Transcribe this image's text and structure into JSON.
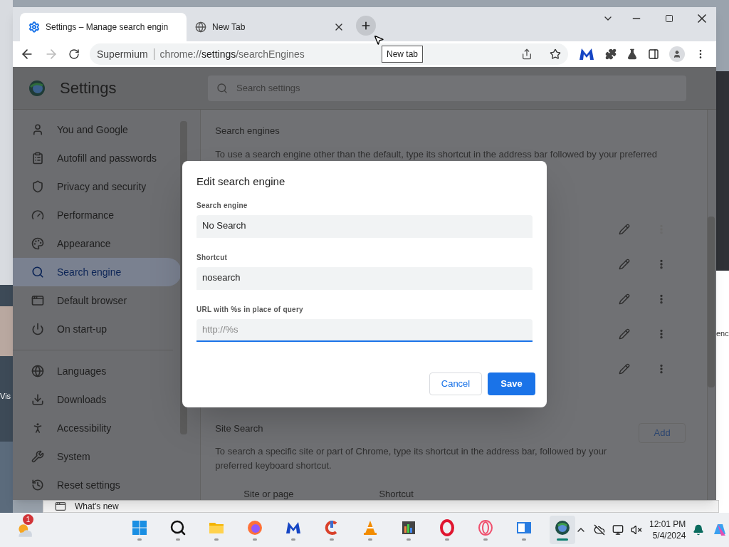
{
  "desktop_fragments": [
    {
      "text": "Vis"
    },
    {
      "text": "enc"
    }
  ],
  "window": {
    "tabs": [
      {
        "title": "Settings – Manage search engin",
        "kind": "settings",
        "selected": true
      },
      {
        "title": "New Tab",
        "kind": "globe",
        "selected": false
      }
    ],
    "tooltip": "New tab",
    "toolbar": {
      "forward_disabled": true,
      "brand": "Supermium",
      "url_prefix": "chrome://",
      "url_host": "settings",
      "url_path": "/searchEngines"
    }
  },
  "settings": {
    "title": "Settings",
    "search_placeholder": "Search settings",
    "sidebar": {
      "groups": [
        [
          {
            "label": "You and Google",
            "selected": false
          },
          {
            "label": "Autofill and passwords",
            "selected": false
          },
          {
            "label": "Privacy and security",
            "selected": false
          },
          {
            "label": "Performance",
            "selected": false
          },
          {
            "label": "Appearance",
            "selected": false
          },
          {
            "label": "Search engine",
            "selected": true
          },
          {
            "label": "Default browser",
            "selected": false
          },
          {
            "label": "On start-up",
            "selected": false
          }
        ],
        [
          {
            "label": "Languages",
            "selected": false
          },
          {
            "label": "Downloads",
            "selected": false
          },
          {
            "label": "Accessibility",
            "selected": false
          },
          {
            "label": "System",
            "selected": false
          },
          {
            "label": "Reset settings",
            "selected": false
          }
        ]
      ]
    },
    "search_engines": {
      "heading": "Search engines",
      "description": "To use a search engine other than the default, type its shortcut in the address bar followed by your preferred",
      "rows": [
        {
          "disabled": true
        },
        {
          "disabled": false
        },
        {
          "disabled": false
        },
        {
          "disabled": false
        },
        {
          "disabled": false
        }
      ]
    },
    "site_search": {
      "heading": "Site Search",
      "description": "To search a specific site or part of Chrome, type its shortcut in the address bar, followed by your preferred keyboard shortcut.",
      "add_button": "Add",
      "columns": [
        "Site or page",
        "Shortcut"
      ]
    }
  },
  "dialog": {
    "title": "Edit search engine",
    "fields": [
      {
        "label": "Search engine",
        "value": "No Search",
        "focused": false
      },
      {
        "label": "Shortcut",
        "value": "nosearch",
        "focused": false
      },
      {
        "label": "URL with %s in place of query",
        "placeholder": "http://%s",
        "focused": true
      }
    ],
    "cancel": "Cancel",
    "save": "Save"
  },
  "background_window": {
    "title": "What's new"
  },
  "taskbar": {
    "weather_badge": "1",
    "time": "12:01 PM",
    "date": "5/4/2024",
    "apps": [
      {
        "kind": "windows",
        "active": false
      },
      {
        "kind": "search",
        "active": false
      },
      {
        "kind": "folder",
        "active": false
      },
      {
        "kind": "firefox",
        "active": false
      },
      {
        "kind": "malwarebytes",
        "active": false
      },
      {
        "kind": "ccleaner",
        "active": false
      },
      {
        "kind": "vlc",
        "active": false
      },
      {
        "kind": "taskmgr",
        "active": false
      },
      {
        "kind": "opera",
        "active": false
      },
      {
        "kind": "operagx",
        "active": false
      },
      {
        "kind": "screen",
        "active": false
      },
      {
        "kind": "supermium",
        "active": true
      }
    ]
  }
}
